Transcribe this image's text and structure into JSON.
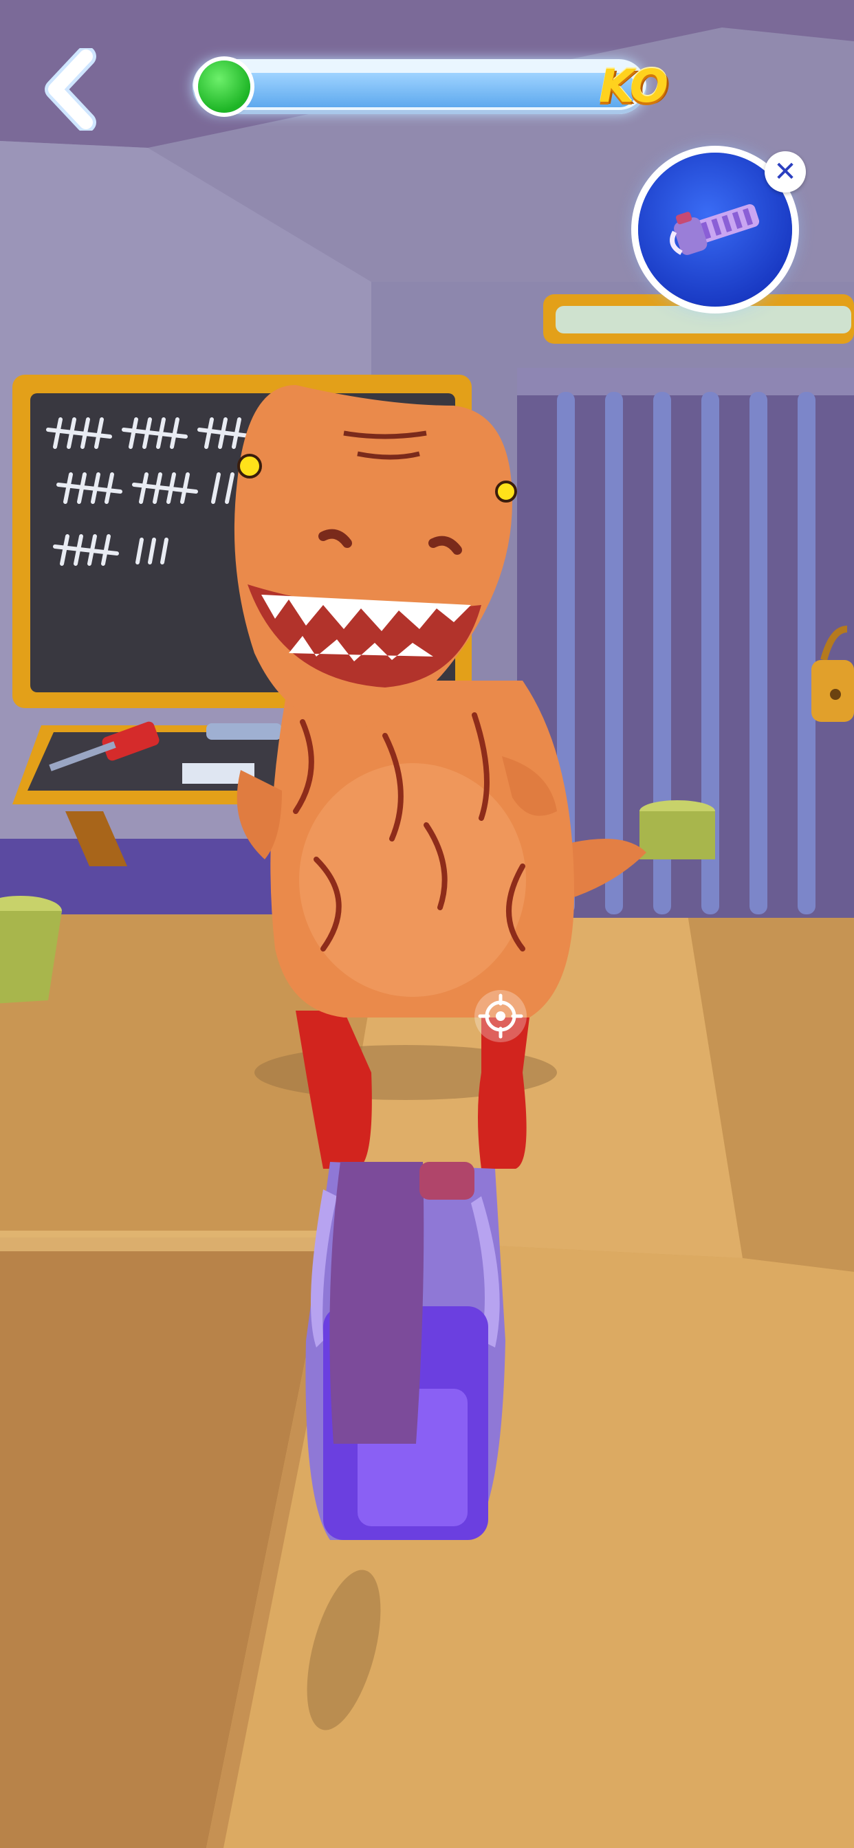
{
  "hud": {
    "ko_label": "KO",
    "ko_progress": 0.0,
    "back_icon": "chevron-left-icon",
    "weapon_icon": "chainsaw-icon",
    "close_icon": "close-icon"
  },
  "scene": {
    "enemy": "orange-t-rex-in-red-heels",
    "player_weapon": "purple-chainsaw",
    "chalkboard_tally_marks": [
      5,
      5,
      5,
      5,
      5,
      5,
      5,
      3
    ],
    "colors": {
      "wall": "#8f88ab",
      "floor": "#d8a65c",
      "dino": "#e98a4c",
      "chalkboard": "#3a3a42",
      "chalkboard_frame": "#e3a019",
      "cage_bars": "#7c86c9",
      "weapon": "#6a48d6",
      "ko_fill": "#2ec431",
      "ko_text": "#ffd21e",
      "badge": "#2c52dc"
    }
  }
}
